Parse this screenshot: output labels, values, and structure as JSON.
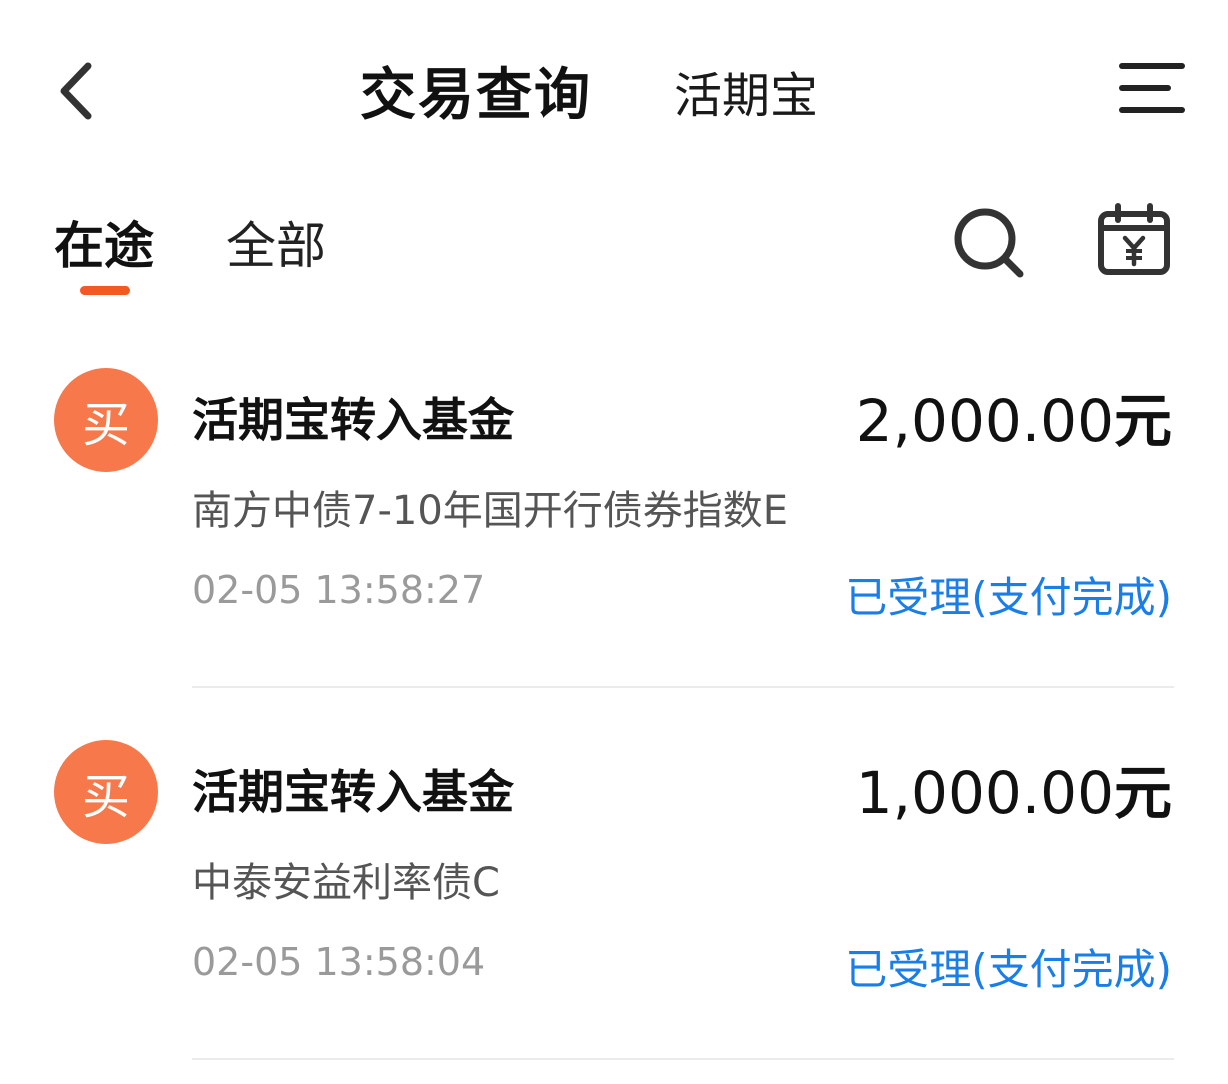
{
  "header": {
    "title": "交易查询",
    "subtitle": "活期宝",
    "back_icon": "chevron-left-icon",
    "menu_icon": "menu-icon"
  },
  "tabs": {
    "active": "在途",
    "inactive": "全部",
    "underline_color": "#f15a22",
    "search_icon": "search-icon",
    "calendar_icon": "calendar-yuan-icon"
  },
  "transactions": [
    {
      "avatar_char": "买",
      "title": "活期宝转入基金",
      "amount": "2,000.00",
      "unit": "元",
      "fund": "南方中债7-10年国开行债券指数E",
      "time": "02-05 13:58:27",
      "status": "已受理(支付完成)"
    },
    {
      "avatar_char": "买",
      "title": "活期宝转入基金",
      "amount": "1,000.00",
      "unit": "元",
      "fund": "中泰安益利率债C",
      "time": "02-05 13:58:04",
      "status": "已受理(支付完成)"
    }
  ],
  "colors": {
    "accent": "#f15a22",
    "avatar_bg": "#f7784a",
    "status_blue": "#1a7ee8"
  }
}
